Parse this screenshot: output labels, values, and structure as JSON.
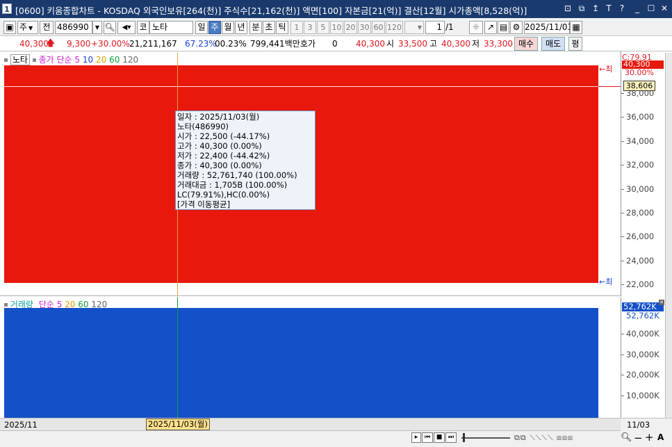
{
  "window": {
    "index_badge": "1",
    "title": "[0600] 키움종합차트 - KOSDAQ 외국인보유[264(천)] 주식수[21,162(천)] 액면[100] 자본금[21(억)] 결산[12월] 시가총액[8,528(억)]",
    "controls": [
      "⊡",
      "⧉",
      "↥",
      "T",
      "?",
      "_",
      "☐",
      "✕"
    ]
  },
  "toolbar": {
    "period_select": "주",
    "all_button": "전",
    "code_value": "486990",
    "market_badge": "코",
    "stock_name": "노타",
    "timeframes": [
      "일",
      "주",
      "월",
      "년",
      "분",
      "초",
      "틱"
    ],
    "active_timeframe": "주",
    "intervals": [
      "1",
      "3",
      "5",
      "10",
      "20",
      "30",
      "60",
      "120"
    ],
    "page_value": "1",
    "page_total": "/1",
    "date_value": "2025/11/03"
  },
  "quote": {
    "price": "40,300",
    "change": "9,300",
    "change_pct": "+30.00%",
    "volume": "21,211,167",
    "ratio1": "67.23%",
    "ratio2": "00.23%",
    "amount": "799,441백만",
    "hoga_label": "호가",
    "hoga_value": "0",
    "hoga_price": "40,300",
    "open_label": "시",
    "open_value": "33,500",
    "high_label": "고",
    "high_value": "40,300",
    "low_label": "저",
    "low_value": "33,300",
    "buy_button": "매수",
    "sell_button": "매도",
    "eval_button": "평"
  },
  "price_panel": {
    "legend_name": "노타",
    "legend_indicator": "종가 단순",
    "ma_periods": [
      "5",
      "10",
      "20",
      "60",
      "120"
    ],
    "ma_colors": [
      "#d01fd0",
      "#1b3fd0",
      "#e0a000",
      "#10a040",
      "#666666"
    ],
    "high_marker": "←최",
    "low_marker": "←최",
    "axis_badge_top": "C:79.91",
    "axis_badge_price": "40,300",
    "axis_badge_pct": "30.00%",
    "axis_badge_cursor": "38,606",
    "axis_ticks": [
      "38,000",
      "36,000",
      "34,000",
      "32,000",
      "30,000",
      "28,000",
      "26,000",
      "24,000",
      "22,000"
    ],
    "candle_color": "#e8180c"
  },
  "volume_panel": {
    "legend_name": "거래량",
    "legend_indicator": "단순",
    "ma_periods": [
      "5",
      "20",
      "60",
      "120"
    ],
    "ma_colors": [
      "#d01fd0",
      "#e0a000",
      "#10a040",
      "#666666"
    ],
    "axis_badge_value": "52,762K",
    "axis_badge_value2": "52,762K",
    "axis_ticks": [
      "40,000K",
      "30,000K",
      "20,000K",
      "10,000K"
    ],
    "bar_color": "#1450c8"
  },
  "tooltip": {
    "lines": [
      "일자      : 2025/11/03(월)",
      "노타(486990)",
      " 시가     : 22,500 (-44.17%)",
      " 고가     : 40,300 (0.00%)",
      " 저가     : 22,400 (-44.42%)",
      " 종가     : 40,300 (0.00%)",
      " 거래량   : 52,761,740 (100.00%)",
      " 거래대금 : 1,705B (100.00%)",
      " LC(79.91%),HC(0.00%)",
      "[가격 이동평균]"
    ]
  },
  "footer": {
    "left_date": "2025/11",
    "cursor_date": "2025/11/03(월)",
    "right_date": "11/03",
    "nav_buttons": [
      "▸",
      "⏮",
      "■",
      "⏭"
    ]
  }
}
